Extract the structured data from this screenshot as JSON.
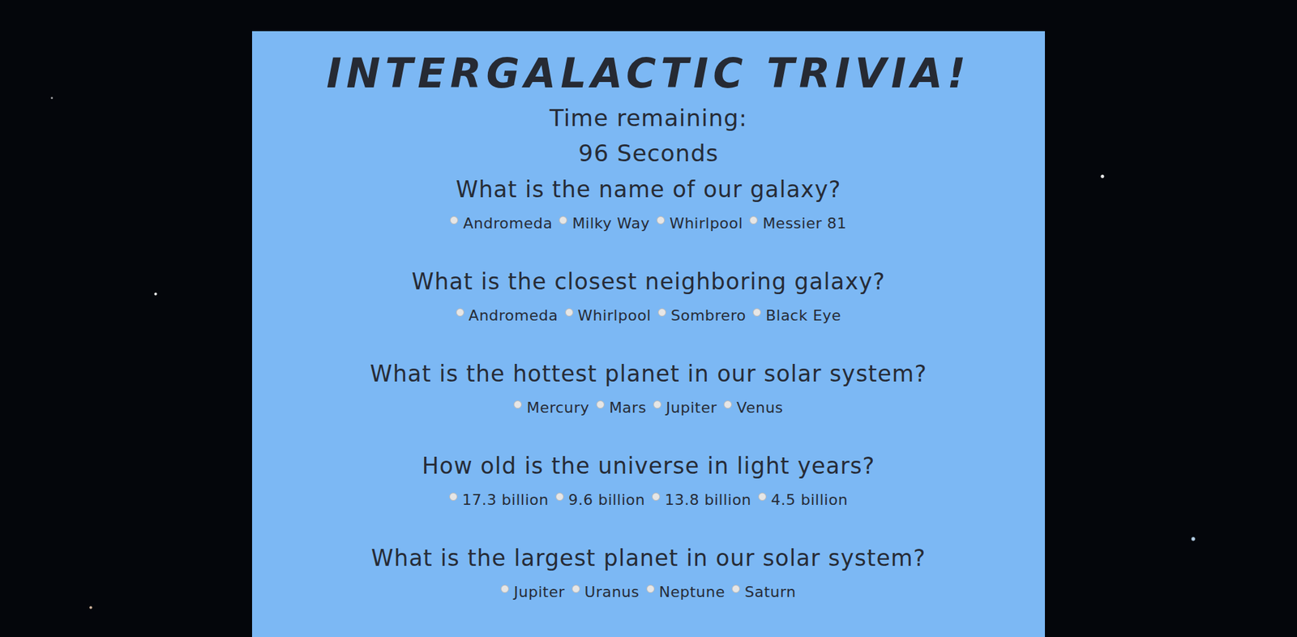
{
  "title": "INTERGALACTIC TRIVIA!",
  "timer": {
    "label": "Time remaining:",
    "value": "96 Seconds"
  },
  "questions": [
    {
      "text": "What is the name of our galaxy?",
      "options": [
        {
          "label": "Andromeda",
          "selected": false
        },
        {
          "label": "Milky Way",
          "selected": false
        },
        {
          "label": "Whirlpool",
          "selected": false
        },
        {
          "label": "Messier 81",
          "selected": false
        }
      ]
    },
    {
      "text": "What is the closest neighboring galaxy?",
      "options": [
        {
          "label": "Andromeda",
          "selected": false
        },
        {
          "label": "Whirlpool",
          "selected": false
        },
        {
          "label": "Sombrero",
          "selected": false
        },
        {
          "label": "Black Eye",
          "selected": false
        }
      ]
    },
    {
      "text": "What is the hottest planet in our solar system?",
      "options": [
        {
          "label": "Mercury",
          "selected": false
        },
        {
          "label": "Mars",
          "selected": false
        },
        {
          "label": "Jupiter",
          "selected": false
        },
        {
          "label": "Venus",
          "selected": false
        }
      ]
    },
    {
      "text": "How old is the universe in light years?",
      "options": [
        {
          "label": "17.3 billion",
          "selected": false
        },
        {
          "label": "9.6 billion",
          "selected": false
        },
        {
          "label": "13.8 billion",
          "selected": false
        },
        {
          "label": "4.5 billion",
          "selected": false
        }
      ]
    },
    {
      "text": "What is the largest planet in our solar system?",
      "options": [
        {
          "label": "Jupiter",
          "selected": false
        },
        {
          "label": "Uranus",
          "selected": false
        },
        {
          "label": "Neptune",
          "selected": false
        },
        {
          "label": "Saturn",
          "selected": false
        }
      ]
    }
  ]
}
